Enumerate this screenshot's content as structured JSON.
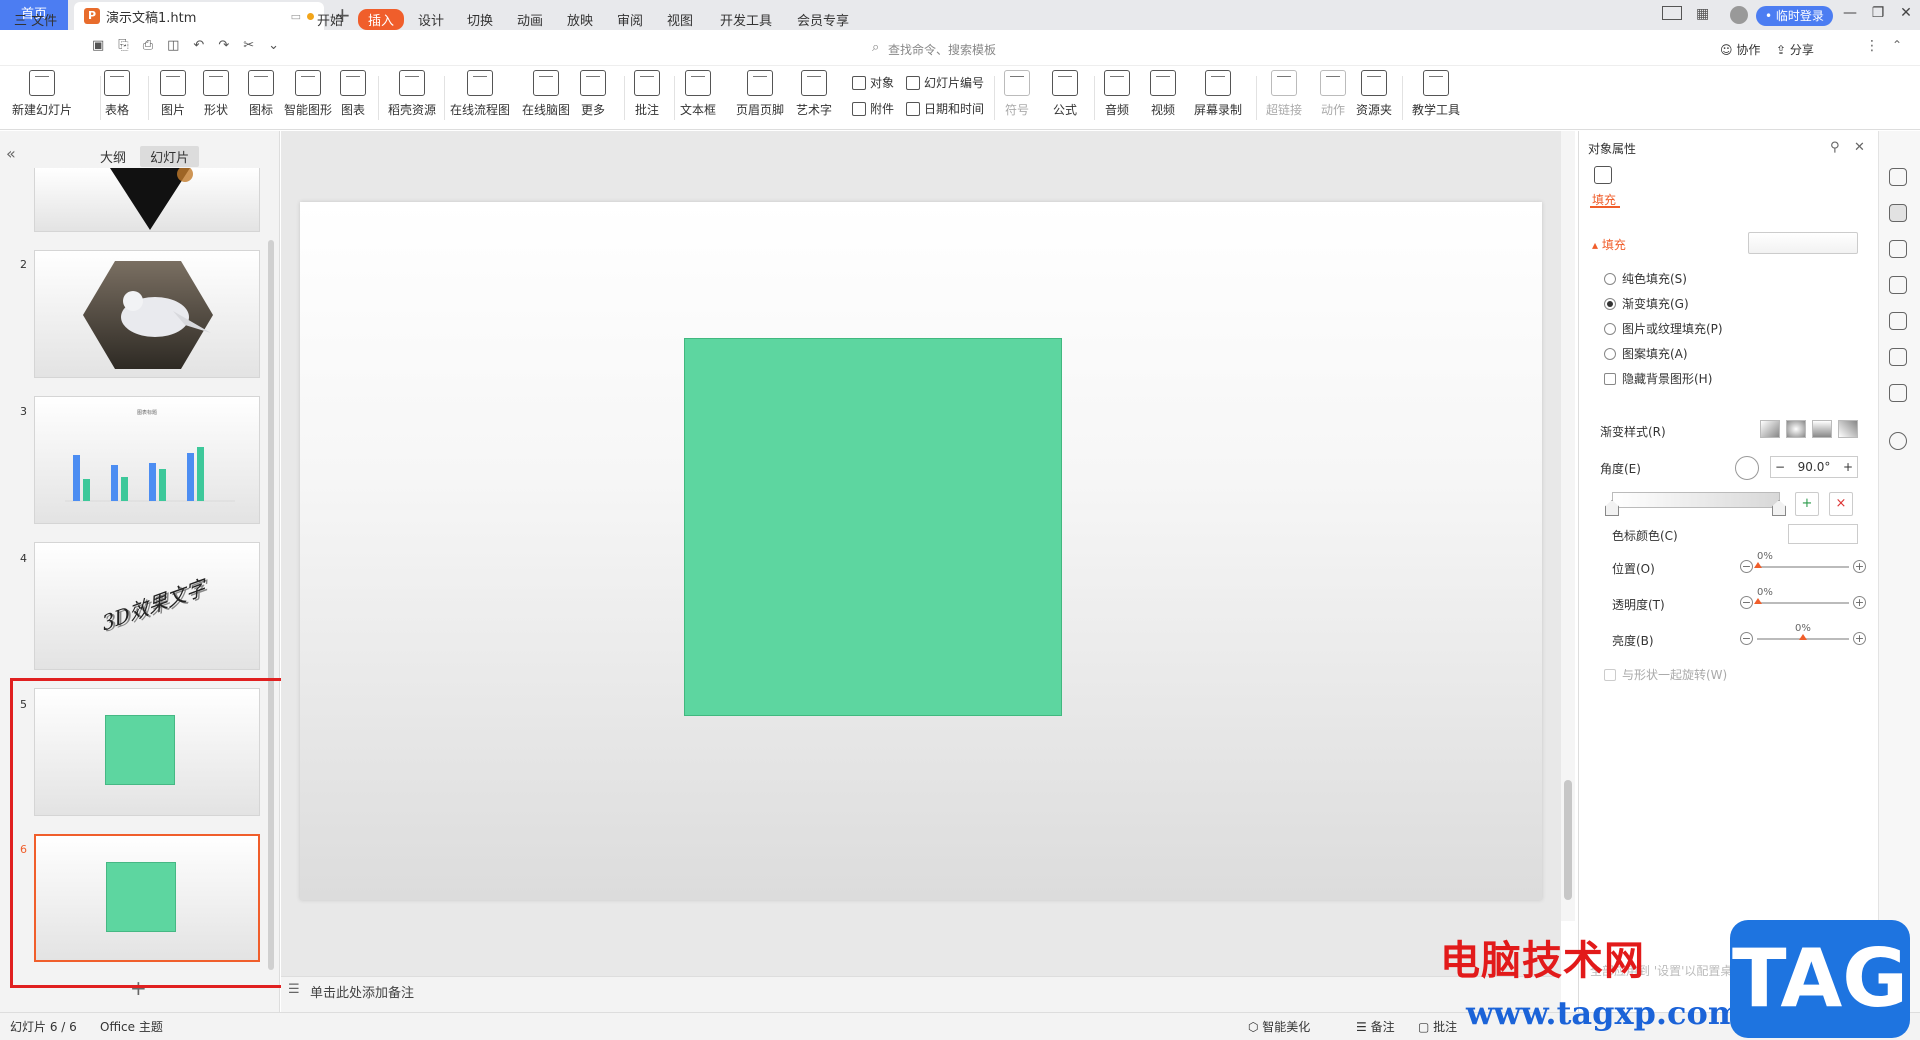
{
  "titlebar": {
    "home_tab": "首页",
    "doc_icon": "P",
    "doc_title": "演示文稿1.htm",
    "new_tab": "+",
    "login_label": "• 临时登录"
  },
  "menu": {
    "file": "三 文件",
    "items": [
      "开始",
      "插入",
      "设计",
      "切换",
      "动画",
      "放映",
      "审阅",
      "视图",
      "开发工具",
      "会员专享"
    ],
    "active": "插入",
    "search_placeholder": "查找命令、搜索模板",
    "collaborate": "协作",
    "share": "分享"
  },
  "ribbon": {
    "buttons": [
      "新建幻灯片",
      "表格",
      "图片",
      "形状",
      "图标",
      "智能图形",
      "图表",
      "稻壳资源",
      "在线流程图",
      "在线脑图",
      "更多",
      "批注",
      "文本框",
      "页眉页脚",
      "艺术字"
    ],
    "small": [
      "对象",
      "附件",
      "幻灯片编号",
      "日期和时间"
    ],
    "buttons2": [
      "符号",
      "公式",
      "音频",
      "视频",
      "屏幕录制",
      "超链接",
      "动作",
      "资源夹",
      "教学工具"
    ]
  },
  "left_panel": {
    "tab_outline": "大纲",
    "tab_slides": "幻灯片",
    "thumb3_title": "图表标题",
    "slide4_text": "3D效果文字",
    "slide_numbers": [
      "2",
      "3",
      "4",
      "5",
      "6"
    ],
    "add_slide": "+"
  },
  "chart_thumb": {
    "series": [
      {
        "color": "#4c8df2",
        "values": [
          46,
          36,
          38,
          48
        ]
      },
      {
        "color": "#3dc89a",
        "values": [
          22,
          24,
          32,
          54
        ]
      }
    ]
  },
  "notes": {
    "placeholder": "单击此处添加备注"
  },
  "right_panel": {
    "title": "对象属性",
    "fill_tab": "填充",
    "fill_section": "填充",
    "options": [
      "纯色填充(S)",
      "渐变填充(G)",
      "图片或纹理填充(P)",
      "图案填充(A)"
    ],
    "selected_option": "渐变填充(G)",
    "hide_bg": "隐藏背景图形(H)",
    "gradient_style": "渐变样式(R)",
    "angle_label": "角度(E)",
    "angle_value": "90.0°",
    "stop_color": "色标颜色(C)",
    "position_label": "位置(O)",
    "position_value": "0%",
    "transparency_label": "透明度(T)",
    "transparency_value": "0%",
    "brightness_label": "亮度(B)",
    "brightness_value": "0%",
    "rotate_with_shape": "与形状一起旋转(W)"
  },
  "status": {
    "slide_counter": "幻灯片 6 / 6",
    "theme": "Office 主题",
    "beautify": "智能美化",
    "notes_btn": "备注",
    "comments_btn": "批注"
  },
  "watermark": {
    "site_cn": "电脑技术网",
    "url": "www.tagxp.com",
    "badge": "TAG",
    "notice": "全部应用到 '设置'以配置桌面"
  },
  "colors": {
    "accent": "#f05e2b",
    "brand": "#4c7df2",
    "shape_fill": "#5dd6a0",
    "annotation": "#e02020"
  }
}
